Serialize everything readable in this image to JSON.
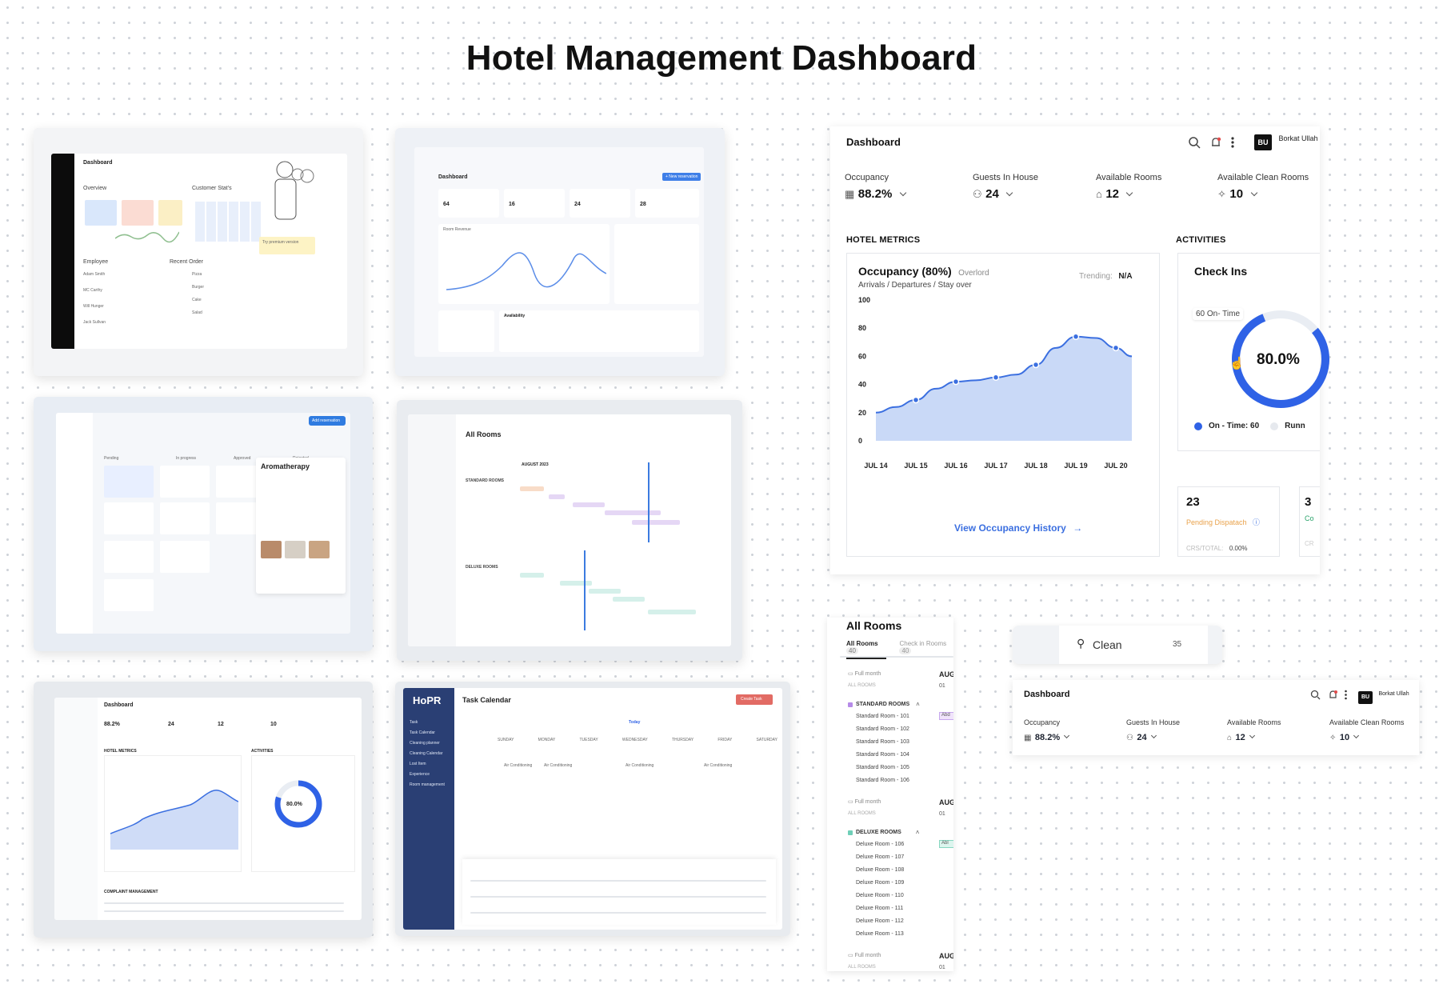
{
  "page_title": "Hotel Management Dashboard",
  "thumbs": {
    "t1": {
      "title": "Dashboard",
      "overview": "Overview",
      "customer_stats": "Customer Stat's",
      "employee": "Employee",
      "recent_order": "Recent Order",
      "promo": "Try premium version",
      "employees": [
        "Adam Smith",
        "MC Carthy",
        "Will Hunger",
        "Jack Sullvan"
      ],
      "orders": [
        "Pizza",
        "Burger",
        "Cake",
        "Salad"
      ]
    },
    "t2": {
      "title": "Dashboard",
      "kpis": [
        "64",
        "16",
        "24",
        "28"
      ],
      "room_revenue": "Room Revenue",
      "availability": "Availability",
      "button": "+ New reservation"
    },
    "t3": {
      "panel_title": "Aromatherapy",
      "columns": [
        "Pending",
        "In progress",
        "Approved",
        "Rejected"
      ],
      "button": "Add reservation"
    },
    "t4": {
      "title": "All Rooms",
      "month": "AUGUST 2023",
      "groups": [
        "STANDARD ROOMS",
        "DELUXE ROOMS"
      ]
    },
    "t5": {
      "title": "Dashboard",
      "occupancy_val": "88.2%",
      "guests_val": "24",
      "rooms_val": "12",
      "clean_val": "10",
      "donut_val": "80.0%",
      "complaint": "COMPLAINT MANAGEMENT",
      "hotel_metrics": "HOTEL METRICS",
      "activities": "ACTIVITIES"
    },
    "t6": {
      "brand": "HoPR",
      "title": "Task Calendar",
      "create_task": "Create Task",
      "today": "Today",
      "days": [
        "SUNDAY",
        "MONDAY",
        "TUESDAY",
        "WEDNESDAY",
        "THURSDAY",
        "FRIDAY",
        "SATURDAY"
      ],
      "task_label": "Air Conditioning",
      "sidebar": [
        "Task",
        "Task Calendar",
        "Cleaning planner",
        "Cleaning Calendar",
        "Lost Item",
        "Experience",
        "Room management"
      ]
    }
  },
  "dashboard": {
    "title": "Dashboard",
    "user_initials": "BU",
    "user_name": "Borkat Ullah",
    "stats": [
      {
        "label": "Occupancy",
        "value": "88.2%",
        "icon": "building-icon"
      },
      {
        "label": "Guests In House",
        "value": "24",
        "icon": "users-icon"
      },
      {
        "label": "Available Rooms",
        "value": "12",
        "icon": "home-icon"
      },
      {
        "label": "Available Clean Rooms",
        "value": "10",
        "icon": "sparkle-icon"
      }
    ],
    "hotel_metrics": "HOTEL METRICS",
    "activities": "ACTIVITIES",
    "occupancy_title": "Occupancy (80%)",
    "occupancy_status": "Overlord",
    "trending_label": "Trending:",
    "trending_value": "N/A",
    "occupancy_subtitle": "Arrivals / Departures / Stay over",
    "history_link": "View Occupancy History",
    "checkins_title": "Check Ins",
    "ontime_badge": "60 On- Time",
    "donut_value": "80.0%",
    "legend_ontime": "On - Time: 60",
    "legend_running": "Runn",
    "pending_count": "23",
    "pending_label": "Pending Dispatach",
    "crs_label": "CRS/TOTAL:",
    "crs_value": "0.00%",
    "second_count": "3",
    "second_label": "Co",
    "second_crs": "CR"
  },
  "chart_data": {
    "type": "area",
    "title": "Occupancy (80%)",
    "x": [
      "JUL 14",
      "JUL 15",
      "JUL 16",
      "JUL 17",
      "JUL 18",
      "JUL 19",
      "JUL 20"
    ],
    "y_ticks": [
      0,
      20,
      40,
      60,
      80,
      100
    ],
    "ylim": [
      0,
      100
    ],
    "points": [
      {
        "x": 0.0,
        "y": 20
      },
      {
        "x": 0.5,
        "y": 24
      },
      {
        "x": 1.0,
        "y": 29
      },
      {
        "x": 1.5,
        "y": 37
      },
      {
        "x": 2.0,
        "y": 42
      },
      {
        "x": 2.5,
        "y": 43
      },
      {
        "x": 3.0,
        "y": 45
      },
      {
        "x": 3.5,
        "y": 47
      },
      {
        "x": 4.0,
        "y": 54
      },
      {
        "x": 4.5,
        "y": 66
      },
      {
        "x": 5.0,
        "y": 74
      },
      {
        "x": 5.5,
        "y": 73
      },
      {
        "x": 6.0,
        "y": 66
      },
      {
        "x": 6.4,
        "y": 60
      }
    ],
    "markers": [
      {
        "x": 1.0,
        "y": 29
      },
      {
        "x": 2.0,
        "y": 42
      },
      {
        "x": 3.0,
        "y": 45
      },
      {
        "x": 4.0,
        "y": 54
      },
      {
        "x": 5.0,
        "y": 74
      },
      {
        "x": 6.0,
        "y": 66
      }
    ],
    "color": "#3b6fe0",
    "fill": "#c9d9f7"
  },
  "donut": {
    "value": 80,
    "color": "#2f62e6",
    "track": "#e9edf3"
  },
  "all_rooms": {
    "title": "All Rooms",
    "tabs": [
      "All Rooms",
      "Check in Rooms"
    ],
    "tab_counts": [
      "40",
      "40"
    ],
    "full_month": "Full month",
    "all_rooms_label": "ALL ROOMS",
    "month_abbr": "AUG",
    "day": "01",
    "standard": "STANDARD ROOMS",
    "standard_rooms": [
      "Standard Room - 101",
      "Standard Room - 102",
      "Standard Room - 103",
      "Standard Room - 104",
      "Standard Room - 105",
      "Standard Room - 106"
    ],
    "deluxe": "DELUXE ROOMS",
    "deluxe_rooms": [
      "Deluxe Room - 106",
      "Deluxe Room - 107",
      "Deluxe Room - 108",
      "Deluxe Room - 109",
      "Deluxe Room - 110",
      "Deluxe Room - 111",
      "Deluxe Room - 112",
      "Deluxe Room - 113"
    ],
    "badge_a": "Abd",
    "badge_b": "Abl"
  },
  "clean_chip": {
    "label": "Clean",
    "count": "35"
  },
  "mini_dashboard": {
    "title": "Dashboard",
    "user_initials": "BU",
    "user_name": "Borkat Ullah",
    "stats": [
      {
        "label": "Occupancy",
        "value": "88.2%"
      },
      {
        "label": "Guests In House",
        "value": "24"
      },
      {
        "label": "Available Rooms",
        "value": "12"
      },
      {
        "label": "Available Clean Rooms",
        "value": "10"
      }
    ]
  }
}
